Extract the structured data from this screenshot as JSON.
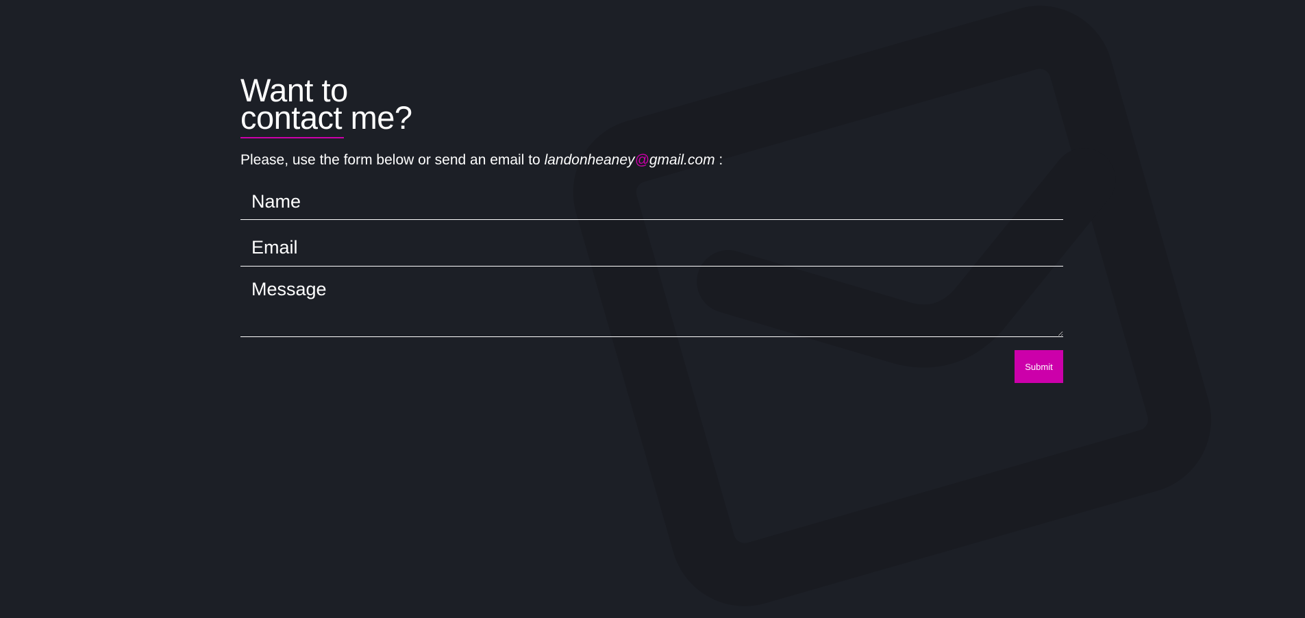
{
  "page": {
    "background_color": "#1c1f26",
    "accent_color": "#cc00aa",
    "background_icon": "mail-outline-icon"
  },
  "heading": {
    "line1": "Want to",
    "line2": "contact me?"
  },
  "intro": {
    "text_before": "Please, use the form below or send an email to ",
    "email_user": "landonheaney",
    "email_at": "@",
    "email_domain": "gmail.com",
    "text_after": ":"
  },
  "form": {
    "name_placeholder": "Name",
    "email_placeholder": "Email",
    "message_placeholder": "Message",
    "submit_label": "Submit"
  }
}
